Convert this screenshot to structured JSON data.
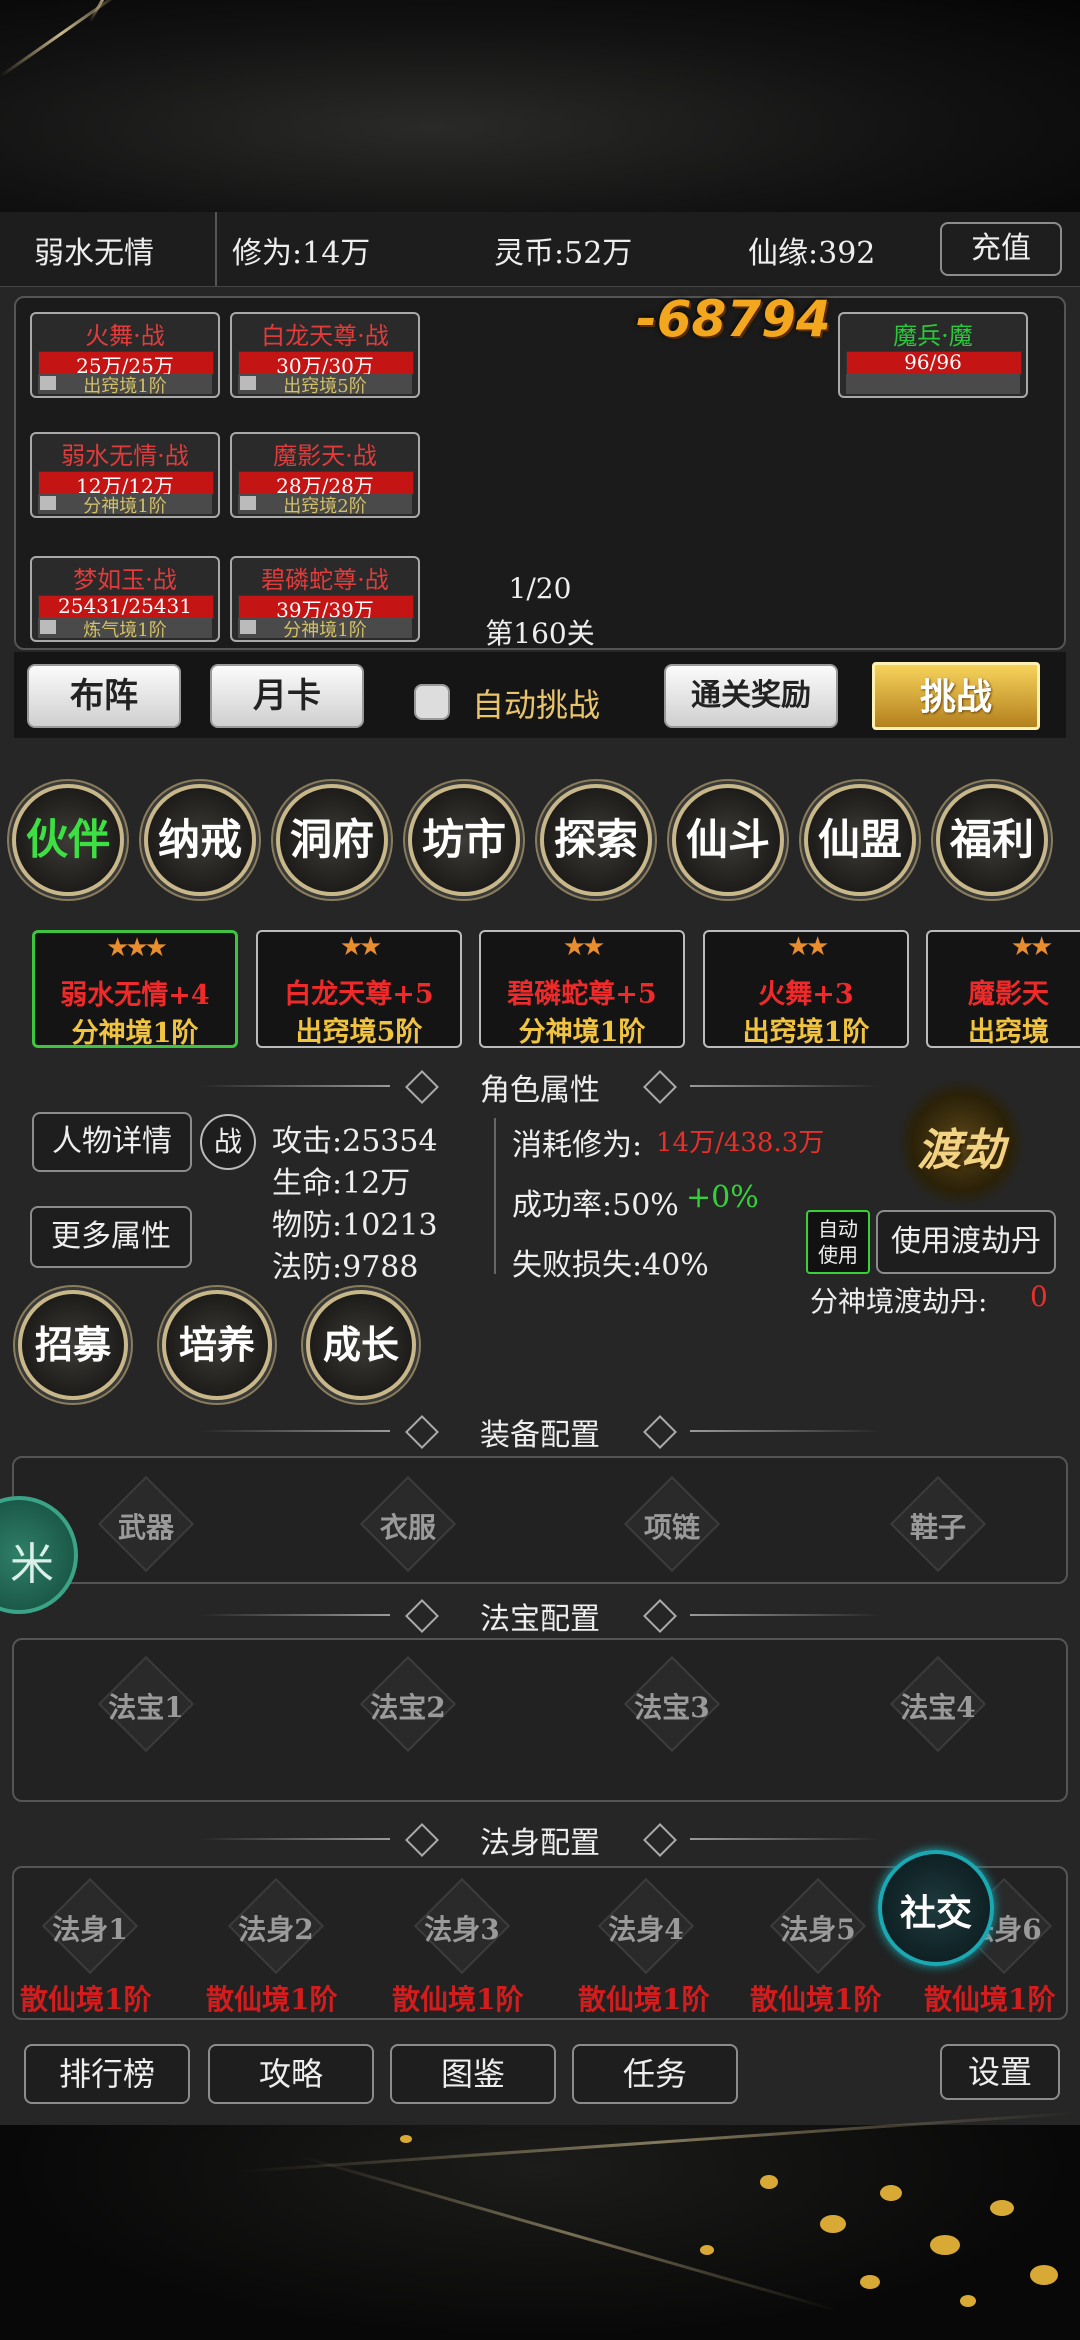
{
  "header": {
    "player_name": "弱水无情",
    "cultivation": "修为:14万",
    "spirit_coin": "灵币:52万",
    "fate": "仙缘:392",
    "recharge_label": "充值"
  },
  "battle": {
    "ally_units": [
      {
        "name": "火舞·战",
        "hp": "25万/25万",
        "rank": "出窍境1阶"
      },
      {
        "name": "白龙天尊·战",
        "hp": "30万/30万",
        "rank": "出窍境5阶"
      },
      {
        "name": "弱水无情·战",
        "hp": "12万/12万",
        "rank": "分神境1阶"
      },
      {
        "name": "魔影天·战",
        "hp": "28万/28万",
        "rank": "出窍境2阶"
      },
      {
        "name": "梦如玉·战",
        "hp": "25431/25431",
        "rank": "炼气境1阶"
      },
      {
        "name": "碧磷蛇尊·战",
        "hp": "39万/39万",
        "rank": "分神境1阶"
      }
    ],
    "enemy_unit": {
      "name": "魔兵·魔",
      "hp": "96/96"
    },
    "damage": "-68794",
    "wave": "1/20",
    "stage": "第160关",
    "formation_label": "布阵",
    "monthly_card_label": "月卡",
    "auto_challenge_label": "自动挑战",
    "clear_reward_label": "通关奖励",
    "challenge_label": "挑战"
  },
  "menu": [
    "伙伴",
    "纳戒",
    "洞府",
    "坊市",
    "探索",
    "仙斗",
    "仙盟",
    "福利"
  ],
  "partners": [
    {
      "stars": "★★★",
      "name": "弱水无情+4",
      "rank": "分神境1阶"
    },
    {
      "stars": "★★",
      "name": "白龙天尊+5",
      "rank": "出窍境5阶"
    },
    {
      "stars": "★★",
      "name": "碧磷蛇尊+5",
      "rank": "分神境1阶"
    },
    {
      "stars": "★★",
      "name": "火舞+3",
      "rank": "出窍境1阶"
    },
    {
      "stars": "★★",
      "name": "魔影天",
      "rank": "出窍境"
    }
  ],
  "attributes": {
    "section_title": "角色属性",
    "detail_button": "人物详情",
    "battle_badge": "战",
    "more_button": "更多属性",
    "attack": "攻击:25354",
    "life": "生命:12万",
    "phys_def": "物防:10213",
    "magic_def": "法防:9788",
    "cost_label": "消耗修为:",
    "cost_value": "14万/438.3万",
    "success_label": "成功率:50%",
    "success_bonus": "+0%",
    "fail_loss": "失败损失:40%",
    "tribulation_icon_text": "渡劫",
    "auto_use_line1": "自动",
    "auto_use_line2": "使用",
    "use_pill_button": "使用渡劫丹",
    "pill_count_label": "分神境渡劫丹:",
    "pill_count": "0"
  },
  "actions": [
    "招募",
    "培养",
    "成长"
  ],
  "equipment": {
    "section_title": "装备配置",
    "slots": [
      "武器",
      "衣服",
      "项链",
      "鞋子"
    ]
  },
  "treasures": {
    "section_title": "法宝配置",
    "slots": [
      "法宝1",
      "法宝2",
      "法宝3",
      "法宝4"
    ]
  },
  "bodies": {
    "section_title": "法身配置",
    "slots": [
      {
        "label": "法身1",
        "realm": "散仙境1阶"
      },
      {
        "label": "法身2",
        "realm": "散仙境1阶"
      },
      {
        "label": "法身3",
        "realm": "散仙境1阶"
      },
      {
        "label": "法身4",
        "realm": "散仙境1阶"
      },
      {
        "label": "法身5",
        "realm": "散仙境1阶"
      },
      {
        "label": "法身6",
        "realm": "散仙境1阶"
      }
    ]
  },
  "floating": {
    "social_label": "社交",
    "side_button_glyph": "米"
  },
  "bottom_nav": {
    "ranking": "排行榜",
    "guide": "攻略",
    "codex": "图鉴",
    "tasks": "任务",
    "settings": "设置"
  },
  "colors": {
    "enemy_name": "#29c93a",
    "damage": "#f3a71e",
    "hp_bar": "#c41414",
    "rank_gold": "#d2bf68",
    "menu_active": "#3de042",
    "cost_red": "#e8302a",
    "bonus_green": "#34d13a",
    "social_teal": "#1aa9b3"
  }
}
